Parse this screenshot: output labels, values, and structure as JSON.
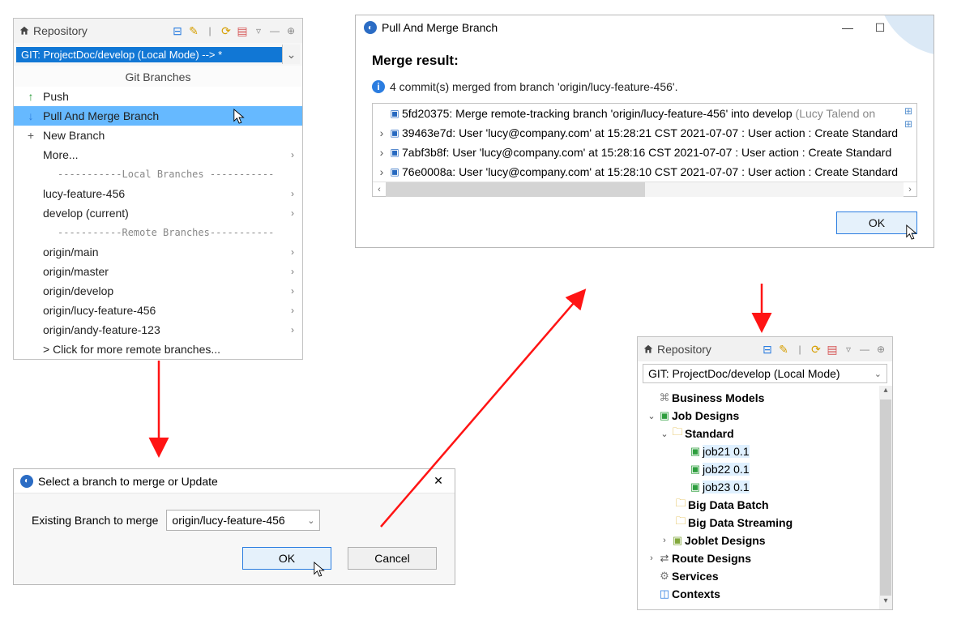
{
  "repoLeft": {
    "title": "Repository",
    "dropdown": "GIT: ProjectDoc/develop   (Local Mode)   --> *",
    "menuTitle": "Git Branches",
    "push": "Push",
    "pullMerge": "Pull And Merge Branch",
    "newBranch": "New Branch",
    "more": "More...",
    "sepLocal": "-----------Local   Branches -----------",
    "localItems": [
      "lucy-feature-456",
      "develop (current)"
    ],
    "sepRemote": "-----------Remote Branches-----------",
    "remoteItems": [
      "origin/main",
      "origin/master",
      "origin/develop",
      "origin/lucy-feature-456",
      "origin/andy-feature-123"
    ],
    "moreRemote": "> Click for more remote branches..."
  },
  "mergeDialog": {
    "title": "Pull And Merge Branch",
    "heading": "Merge result:",
    "infoText": "4 commit(s) merged from branch 'origin/lucy-feature-456'.",
    "commits": [
      {
        "expand": "",
        "hash": "5fd20375",
        "text": ": Merge remote-tracking branch 'origin/lucy-feature-456' into develop ",
        "gray": "(Lucy Talend on"
      },
      {
        "expand": "›",
        "hash": "39463e7d",
        "text": ": User 'lucy@company.com' at 15:28:21 CST 2021-07-07 :  User action : Create Standard",
        "gray": ""
      },
      {
        "expand": "›",
        "hash": "7abf3b8f",
        "text": ": User 'lucy@company.com' at 15:28:16 CST 2021-07-07 :  User action : Create Standard",
        "gray": ""
      },
      {
        "expand": "›",
        "hash": "76e0008a",
        "text": ": User 'lucy@company.com' at 15:28:10 CST 2021-07-07 :  User action : Create Standard",
        "gray": ""
      }
    ],
    "ok": "OK"
  },
  "selectDialog": {
    "title": "Select a branch to merge or Update",
    "label": "Existing Branch to merge",
    "value": "origin/lucy-feature-456",
    "ok": "OK",
    "cancel": "Cancel"
  },
  "repoRight": {
    "title": "Repository",
    "dropdown": "GIT: ProjectDoc/develop   (Local Mode)",
    "tree": {
      "businessModels": "Business Models",
      "jobDesigns": "Job Designs",
      "standard": "Standard",
      "jobs": [
        "job21 0.1",
        "job22 0.1",
        "job23 0.1"
      ],
      "bigDataBatch": "Big Data Batch",
      "bigDataStreaming": "Big Data Streaming",
      "jobletDesigns": "Joblet Designs",
      "routeDesigns": "Route Designs",
      "services": "Services",
      "contexts": "Contexts"
    }
  }
}
